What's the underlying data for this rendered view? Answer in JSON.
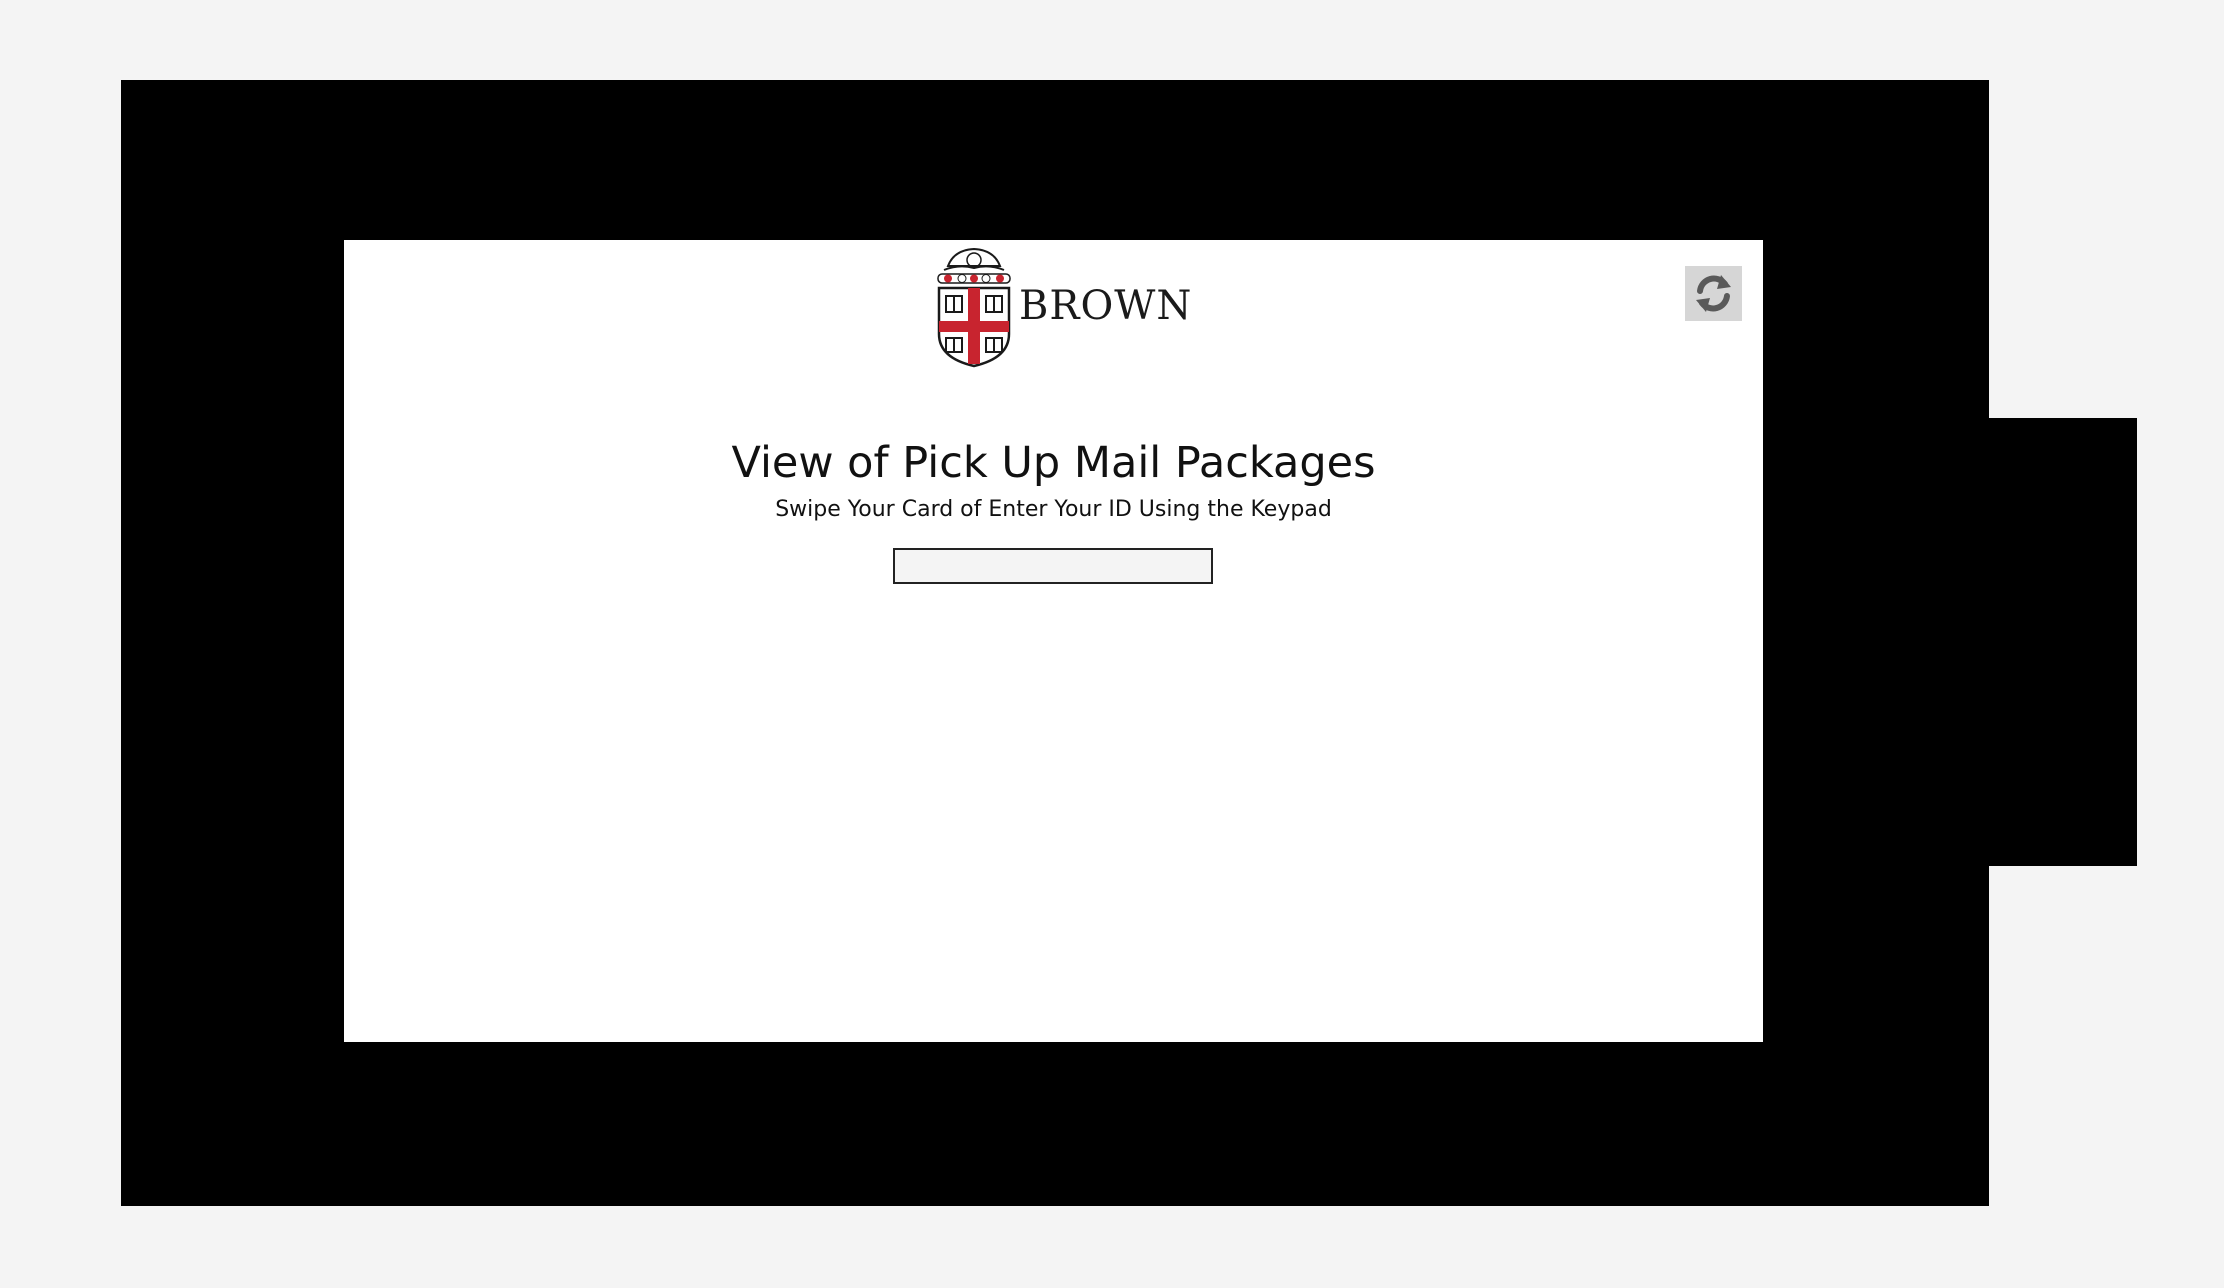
{
  "brand": {
    "name": "BROWN",
    "logo_icon": "brown-university-shield-icon"
  },
  "toolbar": {
    "refresh_icon": "refresh-icon"
  },
  "main": {
    "title": "View of Pick Up Mail Packages",
    "instruction": "Swipe Your Card of Enter Your ID Using the Keypad",
    "id_input": {
      "value": "",
      "placeholder": ""
    }
  },
  "colors": {
    "bezel": "#000000",
    "background": "#f4f4f4",
    "screen": "#ffffff",
    "brand_red": "#c8242f",
    "refresh_button_bg": "#d6d6d6"
  }
}
